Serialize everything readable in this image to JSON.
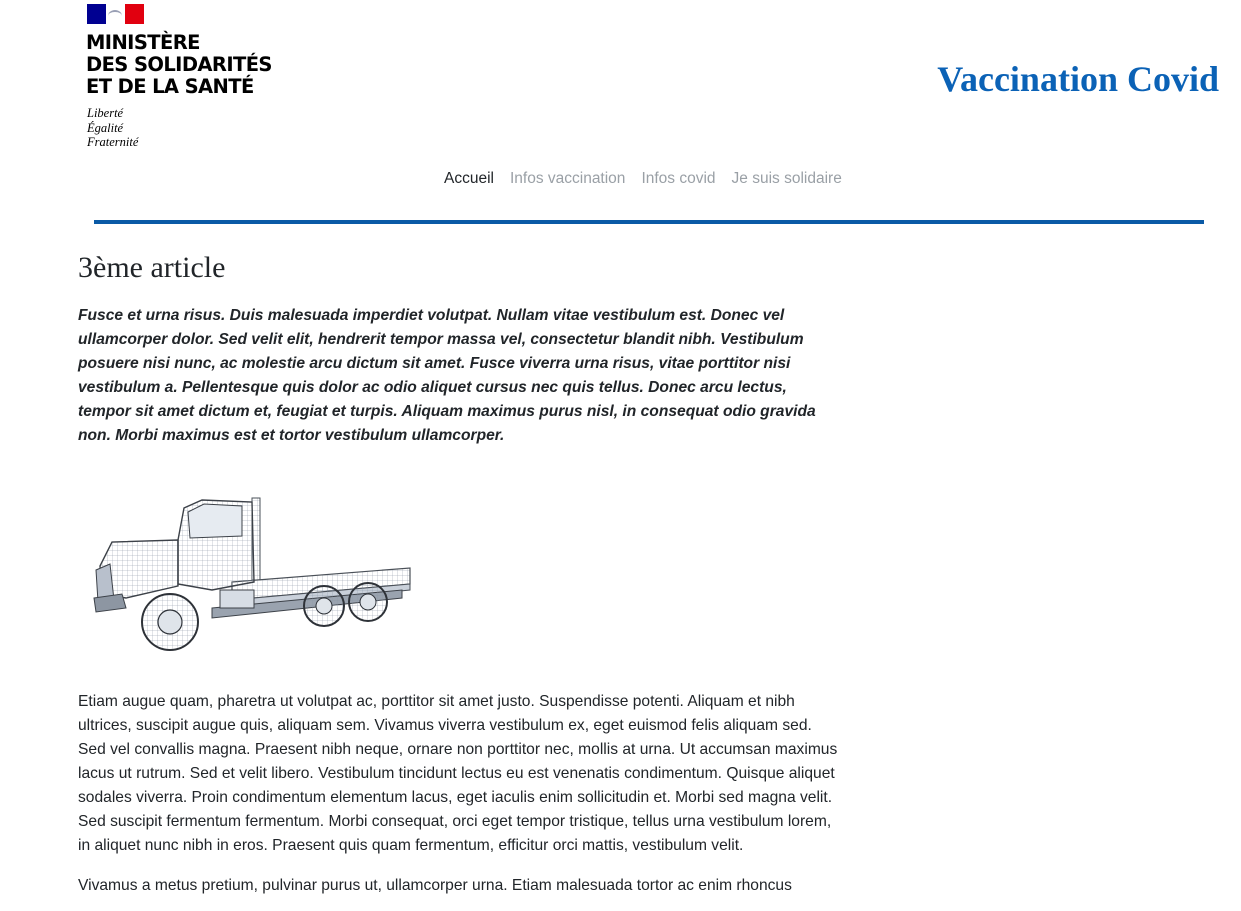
{
  "header": {
    "ministry_lines": [
      "MINISTÈRE",
      "DES SOLIDARITÉS",
      "ET DE LA SANTÉ"
    ],
    "motto_lines": [
      "Liberté",
      "Égalité",
      "Fraternité"
    ],
    "site_title": "Vaccination Covid",
    "title_color": "#0b62b6"
  },
  "nav": {
    "items": [
      {
        "label": "Accueil",
        "active": true
      },
      {
        "label": "Infos vaccination",
        "active": false
      },
      {
        "label": "Infos covid",
        "active": false
      },
      {
        "label": "Je suis solidaire",
        "active": false
      }
    ]
  },
  "accent_color": "#0a5aa6",
  "article": {
    "title": "3ème article",
    "lead": "Fusce et urna risus. Duis malesuada imperdiet volutpat. Nullam vitae vestibulum est. Donec vel ullamcorper dolor. Sed velit elit, hendrerit tempor massa vel, consectetur blandit nibh. Vestibulum posuere nisi nunc, ac molestie arcu dictum sit amet. Fusce viverra urna risus, vitae porttitor nisi vestibulum a. Pellentesque quis dolor ac odio aliquet cursus nec quis tellus. Donec arcu lectus, tempor sit amet dictum et, feugiat et turpis. Aliquam maximus purus nisl, in consequat odio gravida non. Morbi maximus est et tortor vestibulum ullamcorper.",
    "image_icon": "flatbed-truck-wireframe",
    "paragraphs": [
      "Etiam augue quam, pharetra ut volutpat ac, porttitor sit amet justo. Suspendisse potenti. Aliquam et nibh ultrices, suscipit augue quis, aliquam sem. Vivamus viverra vestibulum ex, eget euismod felis aliquam sed. Sed vel convallis magna. Praesent nibh neque, ornare non porttitor nec, mollis at urna. Ut accumsan maximus lacus ut rutrum. Sed et velit libero. Vestibulum tincidunt lectus eu est venenatis condimentum. Quisque aliquet sodales viverra. Proin condimentum elementum lacus, eget iaculis enim sollicitudin et. Morbi sed magna velit. Sed suscipit fermentum fermentum. Morbi consequat, orci eget tempor tristique, tellus urna vestibulum lorem, in aliquet nunc nibh in eros. Praesent quis quam fermentum, efficitur orci mattis, vestibulum velit.",
      "Vivamus a metus pretium, pulvinar purus ut, ullamcorper urna. Etiam malesuada tortor ac enim rhoncus"
    ]
  }
}
